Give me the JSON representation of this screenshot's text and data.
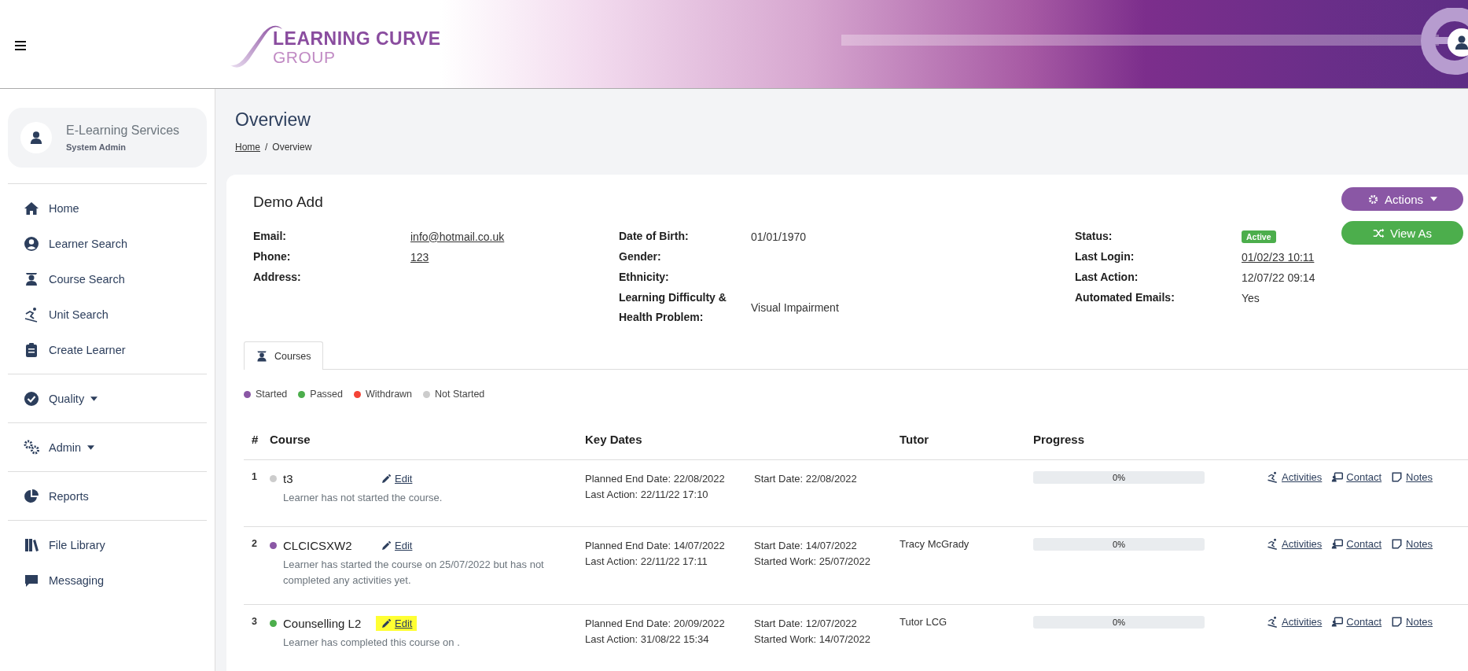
{
  "header": {
    "logo": {
      "line1": "LEARNING CURVE",
      "line2": "GROUP"
    }
  },
  "sidebar": {
    "profile": {
      "name": "E-Learning Services",
      "role": "System Admin"
    },
    "groups": [
      [
        {
          "label": "Home",
          "kind": "home",
          "has_menu": false
        },
        {
          "label": "Learner Search",
          "kind": "person",
          "has_menu": false
        },
        {
          "label": "Course Search",
          "kind": "graduate",
          "has_menu": false
        },
        {
          "label": "Unit Search",
          "kind": "skier",
          "has_menu": false
        },
        {
          "label": "Create Learner",
          "kind": "clipboard",
          "has_menu": false
        }
      ],
      [
        {
          "label": "Quality",
          "kind": "check",
          "has_menu": true
        }
      ],
      [
        {
          "label": "Admin",
          "kind": "gears",
          "has_menu": true
        }
      ],
      [
        {
          "label": "Reports",
          "kind": "pie",
          "has_menu": false
        }
      ],
      [
        {
          "label": "File Library",
          "kind": "books",
          "has_menu": false
        },
        {
          "label": "Messaging",
          "kind": "chat",
          "has_menu": false
        }
      ]
    ]
  },
  "page": {
    "title": "Overview",
    "breadcrumb": {
      "items": [
        "Home",
        "Overview"
      ],
      "separator": "/"
    }
  },
  "learner": {
    "name": "Demo Add",
    "columns": [
      [
        {
          "label": "Email:",
          "value": "info@hotmail.co.uk",
          "kind": "link"
        },
        {
          "label": "Phone:",
          "value": "123",
          "kind": "link"
        },
        {
          "label": "Address:"
        }
      ],
      [
        {
          "label": "Date of Birth:",
          "value": "01/01/1970",
          "kind": "text"
        },
        {
          "label": "Gender:"
        },
        {
          "label": "Ethnicity:"
        },
        {
          "label": "Learning Difficulty & Health Problem:",
          "value": "Visual Impairment",
          "kind": "text"
        }
      ],
      [
        {
          "label": "Status:",
          "value": "Active",
          "kind": "badge"
        },
        {
          "label": "Last Login:",
          "value": "01/02/23 10:11",
          "kind": "link"
        },
        {
          "label": "Last Action:",
          "value": "12/07/22 09:14",
          "kind": "text"
        },
        {
          "label": "Automated Emails:",
          "value": "Yes",
          "kind": "text"
        }
      ]
    ],
    "buttons": [
      {
        "label": "Actions",
        "kind": "menu",
        "color": "#8a57a5"
      },
      {
        "label": "View As",
        "kind": "shuffle",
        "color": "#4cae4c"
      }
    ]
  },
  "tabs": [
    {
      "label": "Courses",
      "selected": true
    }
  ],
  "legend": [
    {
      "label": "Started",
      "color": "#8a57a5"
    },
    {
      "label": "Passed",
      "color": "#4cae4c"
    },
    {
      "label": "Withdrawn",
      "color": "#f44336"
    },
    {
      "label": "Not Started",
      "color": "#cccccc"
    }
  ],
  "table": {
    "columns": [
      "#",
      "Course",
      "Key Dates",
      "Tutor",
      "Progress"
    ],
    "rows": [
      {
        "num": "1",
        "color": "#cccccc",
        "course": "t3",
        "edit": "Edit",
        "highlighted": false,
        "note": "Learner has not started the course.",
        "dates": [
          [
            "Planned End Date: 22/08/2022",
            "Last Action: 22/11/22 17:10"
          ],
          [
            "Start Date: 22/08/2022"
          ]
        ],
        "level": 0,
        "progress": "0%",
        "actions": [
          {
            "label": "Activities",
            "kind": "skier"
          },
          {
            "label": "Contact",
            "kind": "contact"
          },
          {
            "label": "Notes",
            "kind": "note"
          }
        ]
      },
      {
        "num": "2",
        "color": "#8a57a5",
        "course": "CLCICSXW2",
        "edit": "Edit",
        "highlighted": false,
        "note": "Learner has started the course on 25/07/2022 but has not completed any activities yet.",
        "dates": [
          [
            "Planned End Date: 14/07/2022",
            "Last Action: 22/11/22 17:11"
          ],
          [
            "Start Date: 14/07/2022",
            "Started Work: 25/07/2022"
          ]
        ],
        "tutor": "Tracy McGrady",
        "level": 0,
        "progress": "0%",
        "actions": [
          {
            "label": "Activities",
            "kind": "skier"
          },
          {
            "label": "Contact",
            "kind": "contact"
          },
          {
            "label": "Notes",
            "kind": "note"
          }
        ]
      },
      {
        "num": "3",
        "color": "#4cae4c",
        "course": "Counselling L2",
        "edit": "Edit",
        "highlighted": true,
        "note": "Learner has completed this course on .",
        "dates": [
          [
            "Planned End Date: 20/09/2022",
            "Last Action: 31/08/22 15:34"
          ],
          [
            "Start Date: 12/07/2022",
            "Started Work: 14/07/2022"
          ]
        ],
        "tutor": "Tutor LCG",
        "level": 0,
        "progress": "0%",
        "actions": [
          {
            "label": "Activities",
            "kind": "skier"
          },
          {
            "label": "Contact",
            "kind": "contact"
          },
          {
            "label": "Notes",
            "kind": "note"
          }
        ]
      }
    ]
  }
}
